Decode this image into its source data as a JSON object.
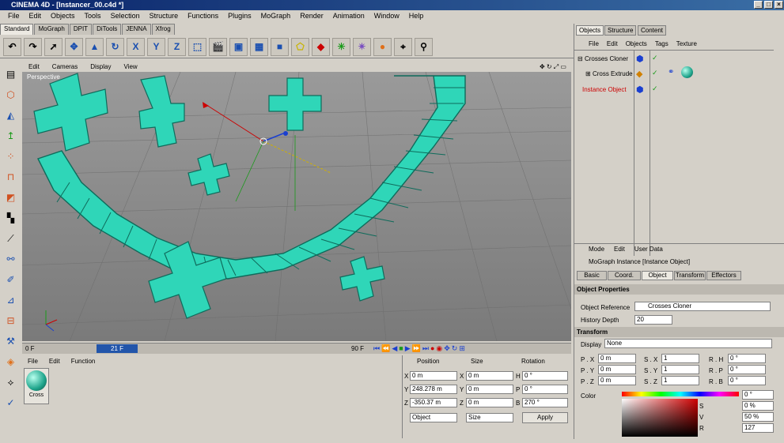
{
  "window": {
    "title": "CINEMA 4D - [Instancer_00.c4d *]"
  },
  "menu": [
    "File",
    "Edit",
    "Objects",
    "Tools",
    "Selection",
    "Structure",
    "Functions",
    "Plugins",
    "MoGraph",
    "Render",
    "Animation",
    "Window",
    "Help"
  ],
  "layout_tabs": [
    "Standard",
    "MoGraph",
    "DPIT",
    "DiTools",
    "JENNA",
    "Xfrog"
  ],
  "viewport": {
    "menu": [
      "Edit",
      "Cameras",
      "Display",
      "View"
    ],
    "label": "Perspective"
  },
  "timeline": {
    "start": "0 F",
    "current": "21 F",
    "end": "90 F"
  },
  "material_panel": {
    "menu": [
      "File",
      "Edit",
      "Function"
    ],
    "material_name": "Cross"
  },
  "coords": {
    "headers": {
      "position": "Position",
      "size": "Size",
      "rotation": "Rotation"
    },
    "pos": {
      "x": "0 m",
      "y": "248.278 m",
      "z": "-350.37 m"
    },
    "size": {
      "x": "0 m",
      "y": "0 m",
      "z": "0 m"
    },
    "rot": {
      "h": "0 °",
      "p": "0 °",
      "b": "270 °"
    },
    "mode_select": "Object",
    "size_select": "Size",
    "apply_label": "Apply"
  },
  "objects_panel": {
    "tabs": [
      "Objects",
      "Structure",
      "Content"
    ],
    "menu": [
      "File",
      "Edit",
      "Objects",
      "Tags",
      "Texture"
    ],
    "items": [
      {
        "name": "Crosses Cloner",
        "color": "#000000"
      },
      {
        "name": "Cross Extrude",
        "color": "#000000"
      },
      {
        "name": "Instance Object",
        "color": "#cc0000"
      }
    ]
  },
  "attributes_panel": {
    "menu": [
      "Mode",
      "Edit",
      "User Data"
    ],
    "object_title": "MoGraph Instance [Instance Object]",
    "tabs": [
      "Basic",
      "Coord.",
      "Object",
      "Transform",
      "Effectors"
    ],
    "section_object": "Object Properties",
    "object_reference_label": "Object Reference",
    "object_reference_value": "Crosses Cloner",
    "history_depth_label": "History Depth",
    "history_depth_value": "20",
    "section_transform": "Transform",
    "display_label": "Display",
    "display_value": "None",
    "p": {
      "x": "0 m",
      "y": "0 m",
      "z": "0 m"
    },
    "s": {
      "x": "1",
      "y": "1",
      "z": "1"
    },
    "r": {
      "h": "0 °",
      "p": "0 °",
      "b": "0 °"
    },
    "color_label": "Color",
    "color_fields": {
      "top": "0 °",
      "s": "0 %",
      "v": "50 %",
      "r": "127"
    },
    "hsv_labels": {
      "s": "S",
      "v": "V",
      "r": "R"
    }
  },
  "colors": {
    "accent_teal": "#2fd6b8",
    "title_blue": "#0a246a",
    "red_text": "#cc0000"
  }
}
